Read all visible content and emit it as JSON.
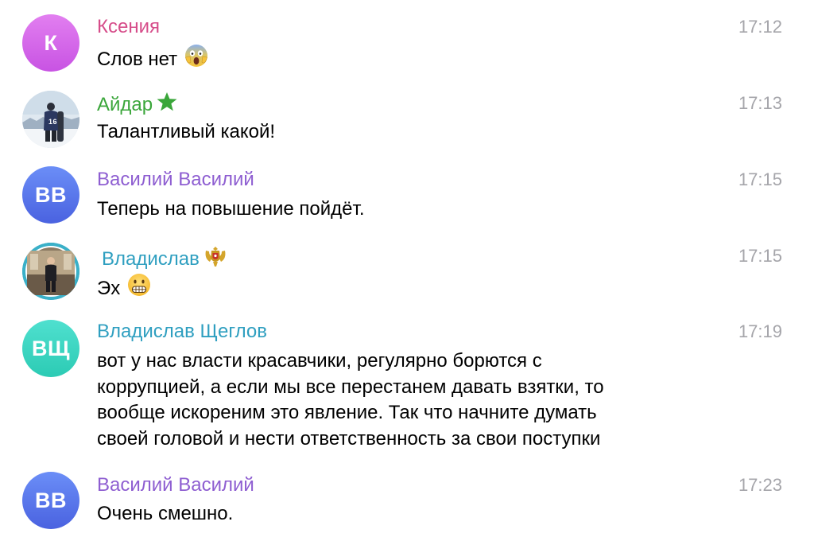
{
  "colors": {
    "ksenia_name": "#d64d8a",
    "aidar_name": "#3aa63a",
    "vasily_name": "#8e5ed1",
    "vladislav_name": "#2f9fc0",
    "vsh_name": "#2f9fc0",
    "time": "#a5a5aa"
  },
  "messages": [
    {
      "name": "Ксения",
      "avatar_initials": "К",
      "time": "17:12",
      "text": "Слов нет",
      "emoji": "screaming-face-icon"
    },
    {
      "name": "Айдар",
      "badge": "green-star-icon",
      "avatar_photo": "snowboarder-photo",
      "time": "17:13",
      "text": "Талантливый какой!"
    },
    {
      "name": "Василий Василий",
      "avatar_initials": "ВВ",
      "time": "17:15",
      "text": "Теперь на повышение пойдёт."
    },
    {
      "name": "Владислав",
      "badge": "coat-of-arms-icon",
      "avatar_photo": "person-photo",
      "time": "17:15",
      "text": "Эх",
      "emoji": "grimacing-face-icon"
    },
    {
      "name": "Владислав Щеглов",
      "avatar_initials": "ВЩ",
      "time": "17:19",
      "lines": [
        "вот у нас власти красавчики, регулярно борются с",
        "коррупцией, а если мы все перестанем давать взятки, то",
        "вообще искореним это явление. Так что начните думать",
        "своей головой и нести ответственность за свои поступки"
      ]
    },
    {
      "name": "Василий Василий",
      "avatar_initials": "ВВ",
      "time": "17:23",
      "text": "Очень смешно."
    }
  ]
}
